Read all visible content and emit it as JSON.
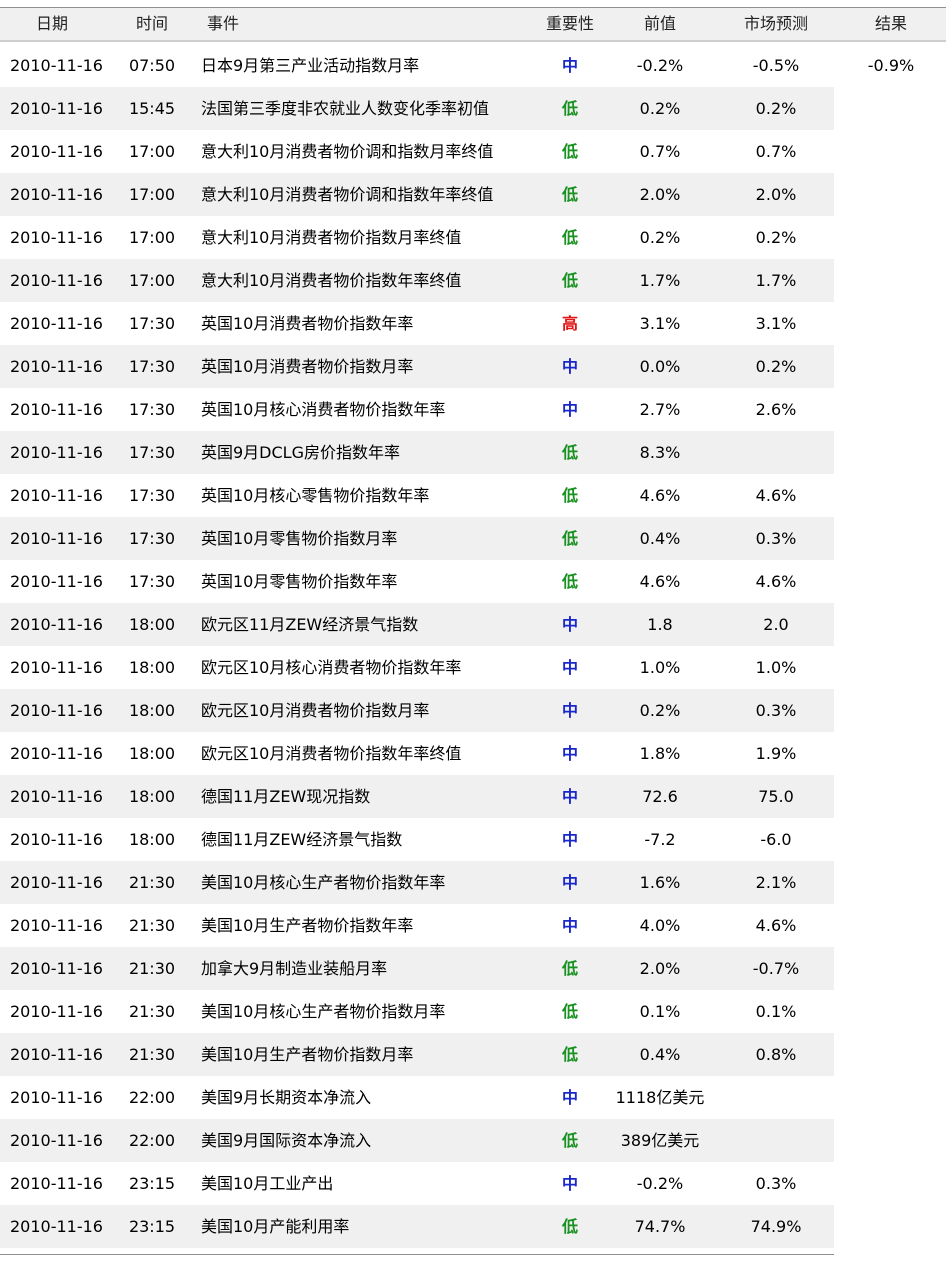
{
  "header": {
    "date": "日期",
    "time": "时间",
    "event": "事件",
    "importance": "重要性",
    "previous": "前值",
    "forecast": "市场预测",
    "actual": "结果"
  },
  "importance_colors": {
    "高": "#e01515",
    "中": "#1a27c9",
    "低": "#17911f"
  },
  "rows": [
    {
      "date": "2010-11-16",
      "time": "07:50",
      "event": "日本9月第三产业活动指数月率",
      "importance": "中",
      "previous": "-0.2%",
      "forecast": "-0.5%",
      "actual": "-0.9%"
    },
    {
      "date": "2010-11-16",
      "time": "15:45",
      "event": "法国第三季度非农就业人数变化季率初值",
      "importance": "低",
      "previous": "0.2%",
      "forecast": "0.2%",
      "actual": ""
    },
    {
      "date": "2010-11-16",
      "time": "17:00",
      "event": "意大利10月消费者物价调和指数月率终值",
      "importance": "低",
      "previous": "0.7%",
      "forecast": "0.7%",
      "actual": ""
    },
    {
      "date": "2010-11-16",
      "time": "17:00",
      "event": "意大利10月消费者物价调和指数年率终值",
      "importance": "低",
      "previous": "2.0%",
      "forecast": "2.0%",
      "actual": ""
    },
    {
      "date": "2010-11-16",
      "time": "17:00",
      "event": "意大利10月消费者物价指数月率终值",
      "importance": "低",
      "previous": "0.2%",
      "forecast": "0.2%",
      "actual": ""
    },
    {
      "date": "2010-11-16",
      "time": "17:00",
      "event": "意大利10月消费者物价指数年率终值",
      "importance": "低",
      "previous": "1.7%",
      "forecast": "1.7%",
      "actual": ""
    },
    {
      "date": "2010-11-16",
      "time": "17:30",
      "event": "英国10月消费者物价指数年率",
      "importance": "高",
      "previous": "3.1%",
      "forecast": "3.1%",
      "actual": ""
    },
    {
      "date": "2010-11-16",
      "time": "17:30",
      "event": "英国10月消费者物价指数月率",
      "importance": "中",
      "previous": "0.0%",
      "forecast": "0.2%",
      "actual": ""
    },
    {
      "date": "2010-11-16",
      "time": "17:30",
      "event": "英国10月核心消费者物价指数年率",
      "importance": "中",
      "previous": "2.7%",
      "forecast": "2.6%",
      "actual": ""
    },
    {
      "date": "2010-11-16",
      "time": "17:30",
      "event": "英国9月DCLG房价指数年率",
      "importance": "低",
      "previous": "8.3%",
      "forecast": "",
      "actual": ""
    },
    {
      "date": "2010-11-16",
      "time": "17:30",
      "event": "英国10月核心零售物价指数年率",
      "importance": "低",
      "previous": "4.6%",
      "forecast": "4.6%",
      "actual": ""
    },
    {
      "date": "2010-11-16",
      "time": "17:30",
      "event": "英国10月零售物价指数月率",
      "importance": "低",
      "previous": "0.4%",
      "forecast": "0.3%",
      "actual": ""
    },
    {
      "date": "2010-11-16",
      "time": "17:30",
      "event": "英国10月零售物价指数年率",
      "importance": "低",
      "previous": "4.6%",
      "forecast": "4.6%",
      "actual": ""
    },
    {
      "date": "2010-11-16",
      "time": "18:00",
      "event": "欧元区11月ZEW经济景气指数",
      "importance": "中",
      "previous": "1.8",
      "forecast": "2.0",
      "actual": ""
    },
    {
      "date": "2010-11-16",
      "time": "18:00",
      "event": "欧元区10月核心消费者物价指数年率",
      "importance": "中",
      "previous": "1.0%",
      "forecast": "1.0%",
      "actual": ""
    },
    {
      "date": "2010-11-16",
      "time": "18:00",
      "event": "欧元区10月消费者物价指数月率",
      "importance": "中",
      "previous": "0.2%",
      "forecast": "0.3%",
      "actual": ""
    },
    {
      "date": "2010-11-16",
      "time": "18:00",
      "event": "欧元区10月消费者物价指数年率终值",
      "importance": "中",
      "previous": "1.8%",
      "forecast": "1.9%",
      "actual": ""
    },
    {
      "date": "2010-11-16",
      "time": "18:00",
      "event": "德国11月ZEW现况指数",
      "importance": "中",
      "previous": "72.6",
      "forecast": "75.0",
      "actual": ""
    },
    {
      "date": "2010-11-16",
      "time": "18:00",
      "event": "德国11月ZEW经济景气指数",
      "importance": "中",
      "previous": "-7.2",
      "forecast": "-6.0",
      "actual": ""
    },
    {
      "date": "2010-11-16",
      "time": "21:30",
      "event": "美国10月核心生产者物价指数年率",
      "importance": "中",
      "previous": "1.6%",
      "forecast": "2.1%",
      "actual": ""
    },
    {
      "date": "2010-11-16",
      "time": "21:30",
      "event": "美国10月生产者物价指数年率",
      "importance": "中",
      "previous": "4.0%",
      "forecast": "4.6%",
      "actual": ""
    },
    {
      "date": "2010-11-16",
      "time": "21:30",
      "event": "加拿大9月制造业装船月率",
      "importance": "低",
      "previous": "2.0%",
      "forecast": "-0.7%",
      "actual": ""
    },
    {
      "date": "2010-11-16",
      "time": "21:30",
      "event": "美国10月核心生产者物价指数月率",
      "importance": "低",
      "previous": "0.1%",
      "forecast": "0.1%",
      "actual": ""
    },
    {
      "date": "2010-11-16",
      "time": "21:30",
      "event": "美国10月生产者物价指数月率",
      "importance": "低",
      "previous": "0.4%",
      "forecast": "0.8%",
      "actual": ""
    },
    {
      "date": "2010-11-16",
      "time": "22:00",
      "event": "美国9月长期资本净流入",
      "importance": "中",
      "previous": "1118亿美元",
      "forecast": "",
      "actual": ""
    },
    {
      "date": "2010-11-16",
      "time": "22:00",
      "event": "美国9月国际资本净流入",
      "importance": "低",
      "previous": "389亿美元",
      "forecast": "",
      "actual": ""
    },
    {
      "date": "2010-11-16",
      "time": "23:15",
      "event": "美国10月工业产出",
      "importance": "中",
      "previous": "-0.2%",
      "forecast": "0.3%",
      "actual": ""
    },
    {
      "date": "2010-11-16",
      "time": "23:15",
      "event": "美国10月产能利用率",
      "importance": "低",
      "previous": "74.7%",
      "forecast": "74.9%",
      "actual": ""
    }
  ]
}
